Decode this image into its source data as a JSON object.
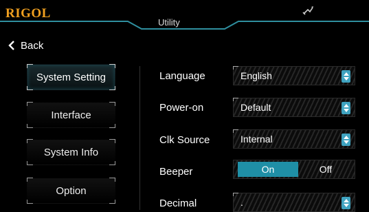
{
  "header": {
    "brand": "RIGOL",
    "title": "Utility"
  },
  "nav": {
    "back_label": "Back"
  },
  "menu": [
    {
      "label": "System Setting",
      "active": true
    },
    {
      "label": "Interface"
    },
    {
      "label": "System Info"
    },
    {
      "label": "Option"
    }
  ],
  "settings": {
    "language": {
      "label": "Language",
      "value": "English"
    },
    "power_on": {
      "label": "Power-on",
      "value": "Default"
    },
    "clk_source": {
      "label": "Clk Source",
      "value": "Internal"
    },
    "beeper": {
      "label": "Beeper",
      "on_label": "On",
      "off_label": "Off",
      "selected": "On"
    },
    "decimal": {
      "label": "Decimal",
      "value": "."
    }
  },
  "colors": {
    "brand": "#f0a020",
    "accent": "#1f8fa6",
    "spinner": "#3fa3c0",
    "header_line": "#2f8f9f"
  }
}
